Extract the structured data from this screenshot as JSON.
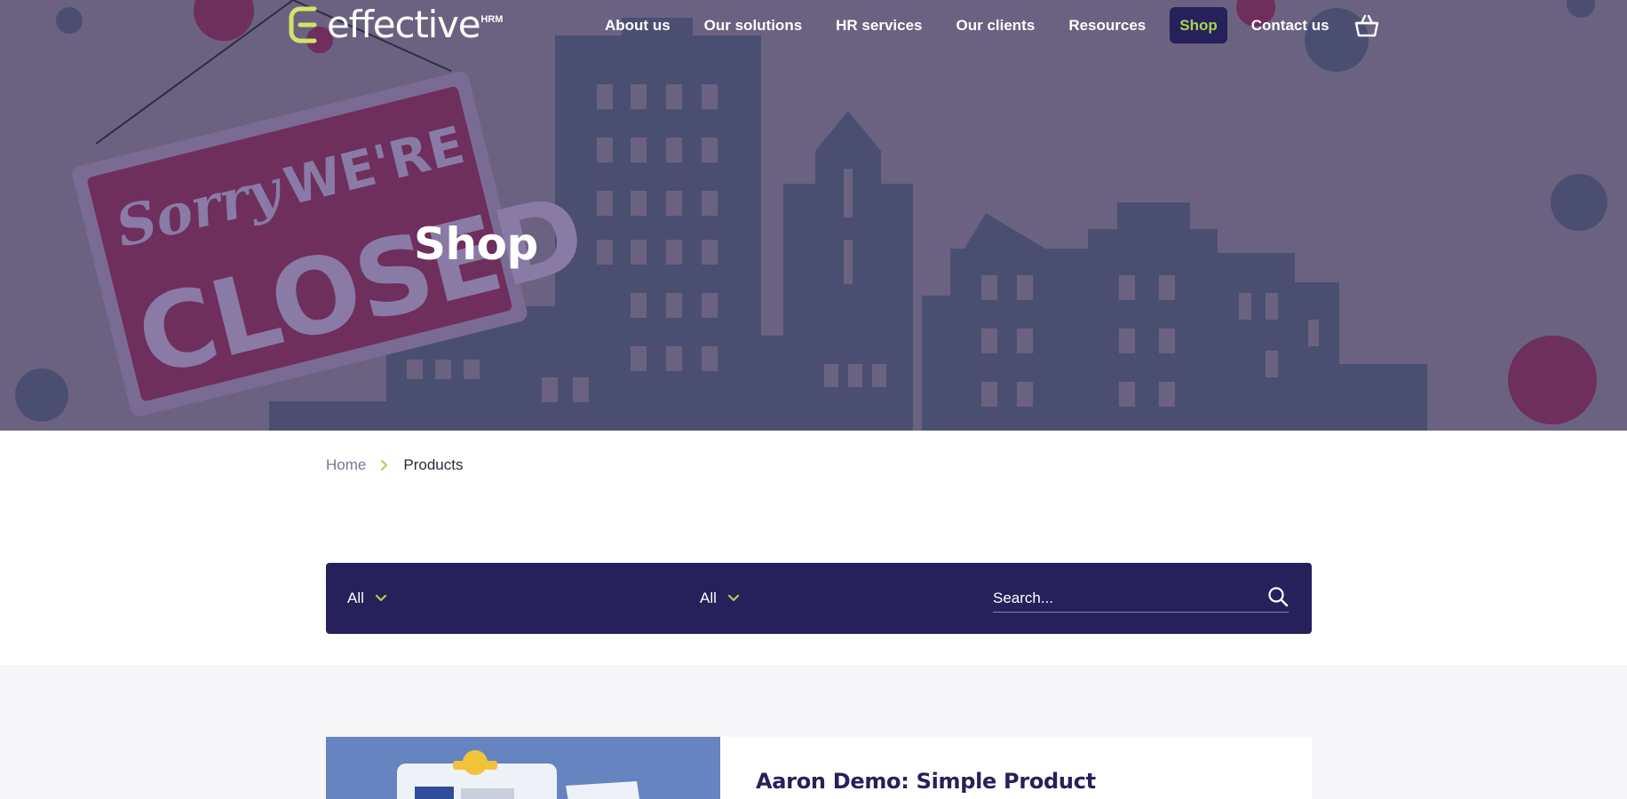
{
  "brand": {
    "name": "effective",
    "suffix": "HRM"
  },
  "nav": {
    "items": [
      {
        "label": "About us",
        "active": false
      },
      {
        "label": "Our solutions",
        "active": false
      },
      {
        "label": "HR services",
        "active": false
      },
      {
        "label": "Our clients",
        "active": false
      },
      {
        "label": "Resources",
        "active": false
      },
      {
        "label": "Shop",
        "active": true
      },
      {
        "label": "Contact us",
        "active": false
      }
    ],
    "cart_icon": "basket-icon"
  },
  "hero": {
    "title": "Shop",
    "sign_line1": "Sorry WE'RE",
    "sign_line2": "CLOSED"
  },
  "breadcrumb": {
    "home": "Home",
    "current": "Products"
  },
  "filters": {
    "filter1_value": "All",
    "filter2_value": "All",
    "search_placeholder": "Search..."
  },
  "products": [
    {
      "title": "Aaron Demo: Simple Product"
    }
  ],
  "colors": {
    "brand_navy": "#26215a",
    "accent_green": "#a6d44c",
    "hero_bg": "#6a6280",
    "products_bg": "#f6f6f8"
  }
}
